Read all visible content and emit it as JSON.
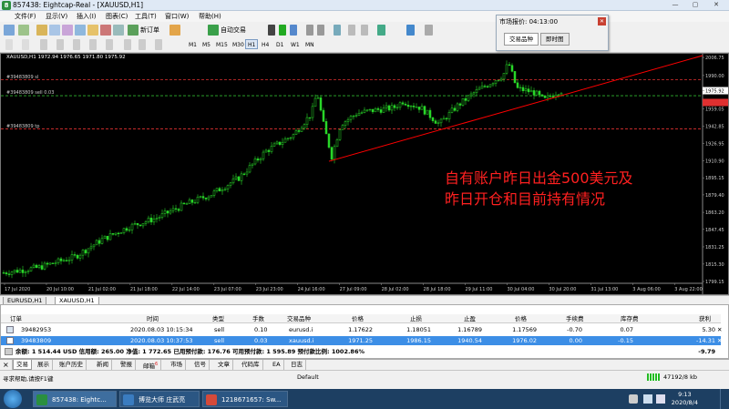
{
  "window": {
    "title": "857438: Eightcap-Real - [XAUUSD,H1]",
    "minimize": "—",
    "maximize": "▢",
    "close": "✕"
  },
  "menu": [
    "文件(F)",
    "显示(V)",
    "插入(I)",
    "图表(C)",
    "工具(T)",
    "窗口(W)",
    "帮助(H)"
  ],
  "toolbar": {
    "new_order": "新订单",
    "auto_trading": "自动交易",
    "timeframes": [
      "M1",
      "M5",
      "M15",
      "M30",
      "H1",
      "H4",
      "D1",
      "W1",
      "MN"
    ],
    "active_timeframe": "H1"
  },
  "market_watch": {
    "title": "市场报价: 04:13:00",
    "tabs": [
      "交易品种",
      "即时图"
    ]
  },
  "chart": {
    "header": "XAUUSD,H1  1972.94 1976.65 1971.80 1975.92",
    "annotation_line1": "自有账户昨日出金500美元及",
    "annotation_line2": "昨日开仓和目前持有情况",
    "order_labels": [
      "#39483809 sl",
      "#39483809 sell 0.03",
      "#39483809 tp"
    ],
    "price_ticks": [
      "2006.75",
      "1990.00",
      "1975.92",
      "1959.05",
      "1942.85",
      "1926.95",
      "1910.90",
      "1895.15",
      "1879.40",
      "1863.20",
      "1847.45",
      "1831.25",
      "1815.30",
      "1799.15"
    ],
    "time_ticks": [
      "17 Jul 2020",
      "20 Jul 10:00",
      "21 Jul 02:00",
      "21 Jul 18:00",
      "22 Jul 14:00",
      "23 Jul 07:00",
      "23 Jul 23:00",
      "24 Jul 16:00",
      "27 Jul 09:00",
      "28 Jul 02:00",
      "28 Jul 18:00",
      "29 Jul 11:00",
      "30 Jul 04:00",
      "30 Jul 20:00",
      "31 Jul 13:00",
      "3 Aug 06:00",
      "3 Aug 22:00"
    ],
    "colors": {
      "bg": "#000000",
      "candle": "#28d628",
      "trendline": "#ff0000",
      "annotation": "#ff2020"
    }
  },
  "chart_tabs": [
    "EURUSD,H1",
    "XAUUSD,H1"
  ],
  "active_chart_tab": "XAUUSD,H1",
  "terminal": {
    "headers": [
      "订单",
      "时间",
      "类型",
      "手数",
      "交易品种",
      "价格",
      "止损",
      "止盈",
      "价格",
      "手续费",
      "库存费",
      "获利"
    ],
    "rows": [
      [
        "39482953",
        "2020.08.03 10:15:34",
        "sell",
        "0.10",
        "eurusd.i",
        "1.17622",
        "1.18051",
        "1.16789",
        "1.17569",
        "-0.70",
        "0.07",
        "5.30"
      ],
      [
        "39483809",
        "2020.08.03 10:37:53",
        "sell",
        "0.03",
        "xauusd.i",
        "1971.25",
        "1986.15",
        "1940.54",
        "1976.02",
        "0.00",
        "-0.15",
        "-14.31"
      ]
    ],
    "summary": "余额: 1 514.44 USD  信用额: 265.00  净值: 1 772.65  已用预付款: 176.76  可用预付款: 1 595.89  预付款比例: 1002.86%",
    "summary_profit": "-9.79"
  },
  "terminal_tabs": [
    "交易",
    "展示",
    "账户历史",
    "新闻",
    "警报",
    "邮箱",
    "市场",
    "信号",
    "文章",
    "代码库",
    "EA",
    "日志"
  ],
  "mail_badge": "6",
  "status": {
    "help": "寻求帮助,请按F1键",
    "profile": "Default",
    "traffic": "47192/8 kb"
  },
  "taskbar": {
    "tasks": [
      "857438: Eightc...",
      "博览大师 庄武亮",
      "1218671657: Sw..."
    ],
    "time": "9:13",
    "date": "2020/8/4"
  }
}
